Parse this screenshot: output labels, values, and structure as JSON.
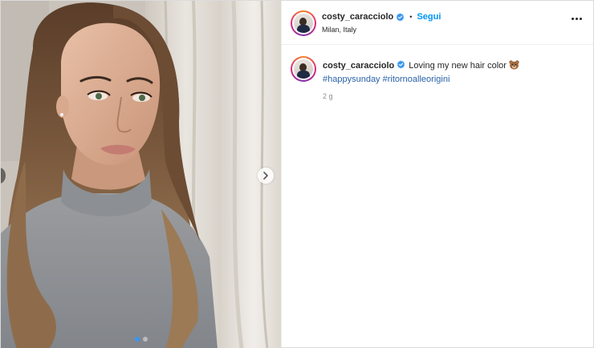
{
  "post": {
    "author": {
      "username": "costy_caracciolo",
      "verified": true,
      "location": "Milan, Italy"
    },
    "follow_label": "Segui",
    "separator": "•",
    "caption": {
      "text": "Loving my new hair color",
      "emoji_icon": "bear-face-icon",
      "hashtags": [
        "#happysunday",
        "#ritornoalleorigini"
      ]
    },
    "timestamp": "2 g"
  },
  "carousel": {
    "total": 2,
    "current": 1
  },
  "colors": {
    "accent": "#0095f6",
    "verified_badge": "#3897f0",
    "hashtag": "#2a62a8",
    "muted_text": "#8e8e8e"
  },
  "icons": {
    "more": "more-options-icon",
    "next": "chevron-right-icon",
    "verified": "verified-badge-icon"
  }
}
